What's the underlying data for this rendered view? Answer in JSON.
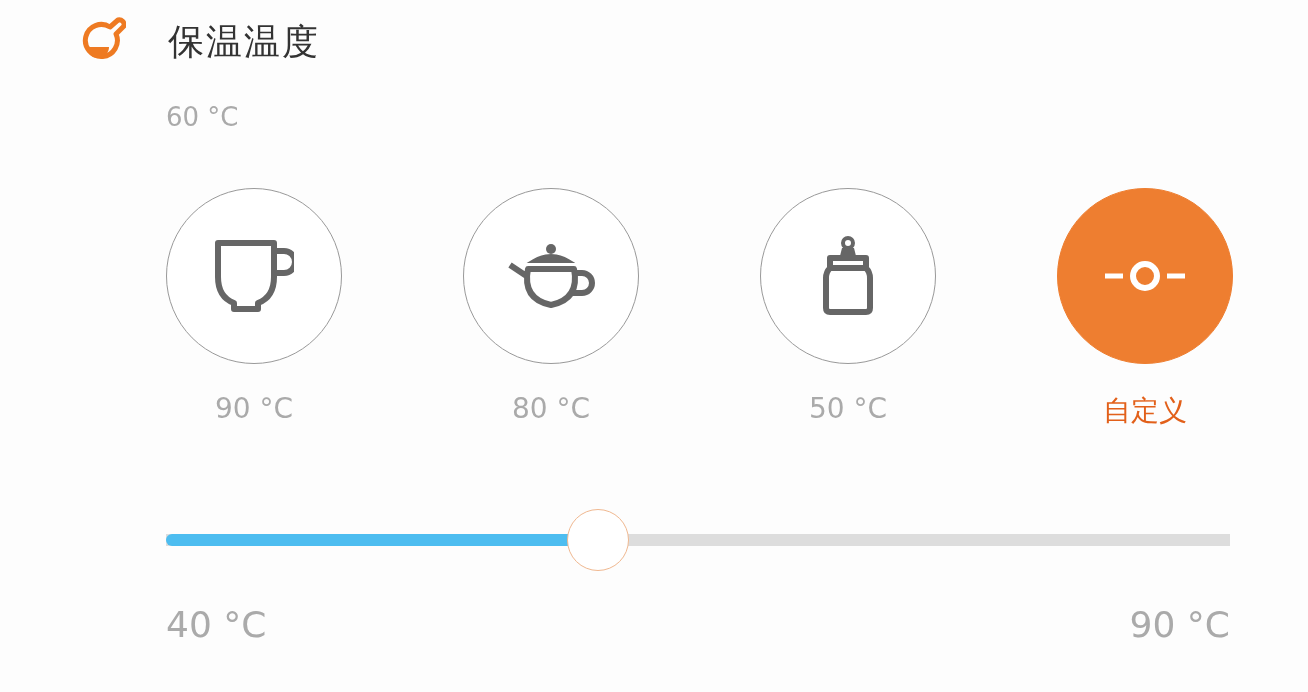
{
  "header": {
    "title": "保温温度"
  },
  "current": "60 °C",
  "presets": [
    {
      "kind": "cup",
      "label": "90 °C",
      "selected": false
    },
    {
      "kind": "teapot",
      "label": "80 °C",
      "selected": false
    },
    {
      "kind": "bottle",
      "label": "50 °C",
      "selected": false
    },
    {
      "kind": "custom",
      "label": "自定义",
      "selected": true
    }
  ],
  "slider": {
    "level": 0.406,
    "min": "40 °C",
    "max": "90 °C"
  }
}
